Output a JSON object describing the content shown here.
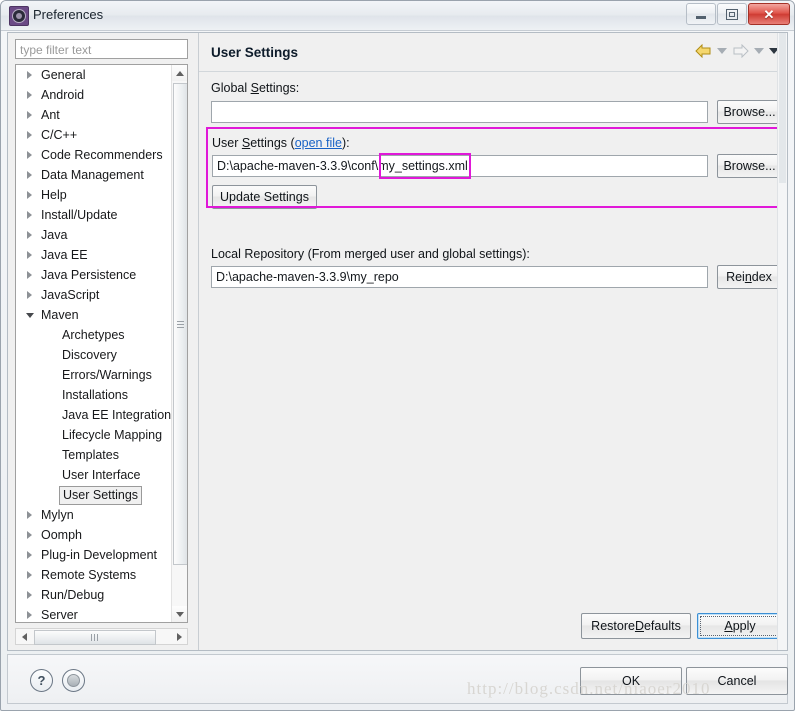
{
  "window": {
    "title": "Preferences",
    "icon": "gear-icon",
    "controls": {
      "minimize": "minimize-icon",
      "maximize": "restore-icon",
      "close": "✕"
    }
  },
  "sidebar": {
    "filter_placeholder": "type filter text",
    "filter_value": "",
    "items": [
      {
        "label": "General",
        "level": 0,
        "expandable": true,
        "expanded": false,
        "selected": false
      },
      {
        "label": "Android",
        "level": 0,
        "expandable": true,
        "expanded": false,
        "selected": false
      },
      {
        "label": "Ant",
        "level": 0,
        "expandable": true,
        "expanded": false,
        "selected": false
      },
      {
        "label": "C/C++",
        "level": 0,
        "expandable": true,
        "expanded": false,
        "selected": false
      },
      {
        "label": "Code Recommenders",
        "level": 0,
        "expandable": true,
        "expanded": false,
        "selected": false
      },
      {
        "label": "Data Management",
        "level": 0,
        "expandable": true,
        "expanded": false,
        "selected": false
      },
      {
        "label": "Help",
        "level": 0,
        "expandable": true,
        "expanded": false,
        "selected": false
      },
      {
        "label": "Install/Update",
        "level": 0,
        "expandable": true,
        "expanded": false,
        "selected": false
      },
      {
        "label": "Java",
        "level": 0,
        "expandable": true,
        "expanded": false,
        "selected": false
      },
      {
        "label": "Java EE",
        "level": 0,
        "expandable": true,
        "expanded": false,
        "selected": false
      },
      {
        "label": "Java Persistence",
        "level": 0,
        "expandable": true,
        "expanded": false,
        "selected": false
      },
      {
        "label": "JavaScript",
        "level": 0,
        "expandable": true,
        "expanded": false,
        "selected": false
      },
      {
        "label": "Maven",
        "level": 0,
        "expandable": true,
        "expanded": true,
        "selected": false
      },
      {
        "label": "Archetypes",
        "level": 1,
        "expandable": false,
        "expanded": false,
        "selected": false
      },
      {
        "label": "Discovery",
        "level": 1,
        "expandable": false,
        "expanded": false,
        "selected": false
      },
      {
        "label": "Errors/Warnings",
        "level": 1,
        "expandable": false,
        "expanded": false,
        "selected": false
      },
      {
        "label": "Installations",
        "level": 1,
        "expandable": false,
        "expanded": false,
        "selected": false
      },
      {
        "label": "Java EE Integration",
        "level": 1,
        "expandable": false,
        "expanded": false,
        "selected": false
      },
      {
        "label": "Lifecycle Mapping",
        "level": 1,
        "expandable": false,
        "expanded": false,
        "selected": false
      },
      {
        "label": "Templates",
        "level": 1,
        "expandable": false,
        "expanded": false,
        "selected": false
      },
      {
        "label": "User Interface",
        "level": 1,
        "expandable": false,
        "expanded": false,
        "selected": false
      },
      {
        "label": "User Settings",
        "level": 1,
        "expandable": false,
        "expanded": false,
        "selected": true
      },
      {
        "label": "Mylyn",
        "level": 0,
        "expandable": true,
        "expanded": false,
        "selected": false
      },
      {
        "label": "Oomph",
        "level": 0,
        "expandable": true,
        "expanded": false,
        "selected": false
      },
      {
        "label": "Plug-in Development",
        "level": 0,
        "expandable": true,
        "expanded": false,
        "selected": false
      },
      {
        "label": "Remote Systems",
        "level": 0,
        "expandable": true,
        "expanded": false,
        "selected": false
      },
      {
        "label": "Run/Debug",
        "level": 0,
        "expandable": true,
        "expanded": false,
        "selected": false
      },
      {
        "label": "Server",
        "level": 0,
        "expandable": true,
        "expanded": false,
        "selected": false
      }
    ]
  },
  "main": {
    "page_title": "User Settings",
    "nav": {
      "back_icon": "back-arrow-icon",
      "back_dropdown_icon": "chevron-down-icon",
      "forward_icon": "forward-arrow-icon",
      "forward_dropdown_icon": "chevron-down-icon",
      "menu_icon": "chevron-down-icon"
    },
    "global_settings": {
      "label_pre": "Global ",
      "label_mnemonic": "S",
      "label_post": "ettings:",
      "value": "",
      "browse_label": "Browse..."
    },
    "user_settings": {
      "label_pre": "User ",
      "label_mnemonic": "S",
      "label_mid": "ettings (",
      "link": "open file",
      "label_post": "):",
      "path_prefix": "D:\\apache-maven-3.3.9\\conf\\",
      "path_filename": "my_settings.xml",
      "value": "D:\\apache-maven-3.3.9\\conf\\my_settings.xml",
      "browse_label": "Browse...",
      "update_label": "Update Settings"
    },
    "local_repository": {
      "label": "Local Repository (From merged user and global settings):",
      "value": "D:\\apache-maven-3.3.9\\my_repo",
      "reindex_pre": "Rei",
      "reindex_mnemonic": "n",
      "reindex_post": "dex"
    },
    "restore_defaults": {
      "pre": "Restore ",
      "mnemonic": "D",
      "post": "efaults"
    },
    "apply": {
      "pre": "",
      "mnemonic": "A",
      "post": "pply"
    }
  },
  "footer": {
    "help_icon": "question-mark-icon",
    "extra_icon": "circle-button-icon",
    "ok_label": "OK",
    "cancel_label": "Cancel"
  },
  "watermark": "http://blog.csdn.net/niaoer2010",
  "colors": {
    "annotation": "#e018d8",
    "link": "#1862c6",
    "title_icon": "#6b4a86",
    "close_button": "#cf3c33",
    "focus_border": "#3c8fd4"
  }
}
